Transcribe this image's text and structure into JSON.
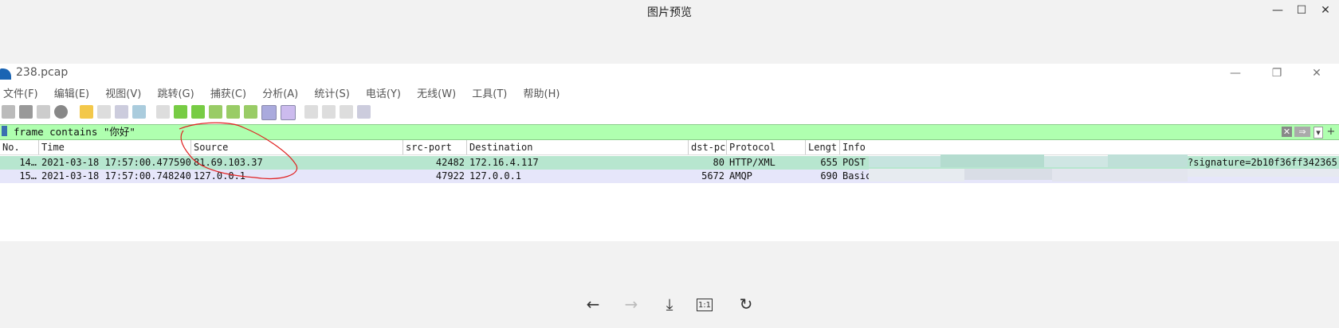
{
  "viewer": {
    "title": "图片预览",
    "controls": {
      "minimize": "—",
      "maximize": "☐",
      "close": "✕"
    },
    "nav": {
      "prev": "←",
      "next": "→",
      "download": "⤓",
      "actual_size": "1:1",
      "rotate": "↻"
    }
  },
  "wireshark": {
    "title": "238.pcap",
    "controls": {
      "minimize": "—",
      "restore": "❐",
      "close": "✕"
    },
    "menu": [
      "文件(F)",
      "编辑(E)",
      "视图(V)",
      "跳转(G)",
      "捕获(C)",
      "分析(A)",
      "统计(S)",
      "电话(Y)",
      "无线(W)",
      "工具(T)",
      "帮助(H)"
    ],
    "filter": {
      "text": "frame contains \"你好\"",
      "clear": "✕",
      "apply": "⇒",
      "dropdown": "▾",
      "add": "+"
    },
    "columns": [
      "No.",
      "Time",
      "Source",
      "src-port",
      "Destination",
      "dst-pc",
      "Protocol",
      "Lengt",
      "Info"
    ],
    "rows": [
      {
        "no": "14…",
        "time": "2021-03-18 17:57:00.477590",
        "source": "81.69.103.37",
        "src_port": "42482",
        "destination": "172.16.4.117",
        "dst_port": "80",
        "protocol": "HTTP/XML",
        "length": "655",
        "info": "POST",
        "info_tail": "?signature=2b10f36ff342365"
      },
      {
        "no": "15…",
        "time": "2021-03-18 17:57:00.748240",
        "source": "127.0.0.1",
        "src_port": "47922",
        "destination": "127.0.0.1",
        "dst_port": "5672",
        "protocol": "AMQP",
        "length": "690",
        "info": "Basic"
      }
    ],
    "colors": {
      "row_http": "#b7e6cf",
      "row_amqp": "#e6e6fa",
      "filter_bg": "#afffaf",
      "annotation": "#e02020"
    }
  }
}
